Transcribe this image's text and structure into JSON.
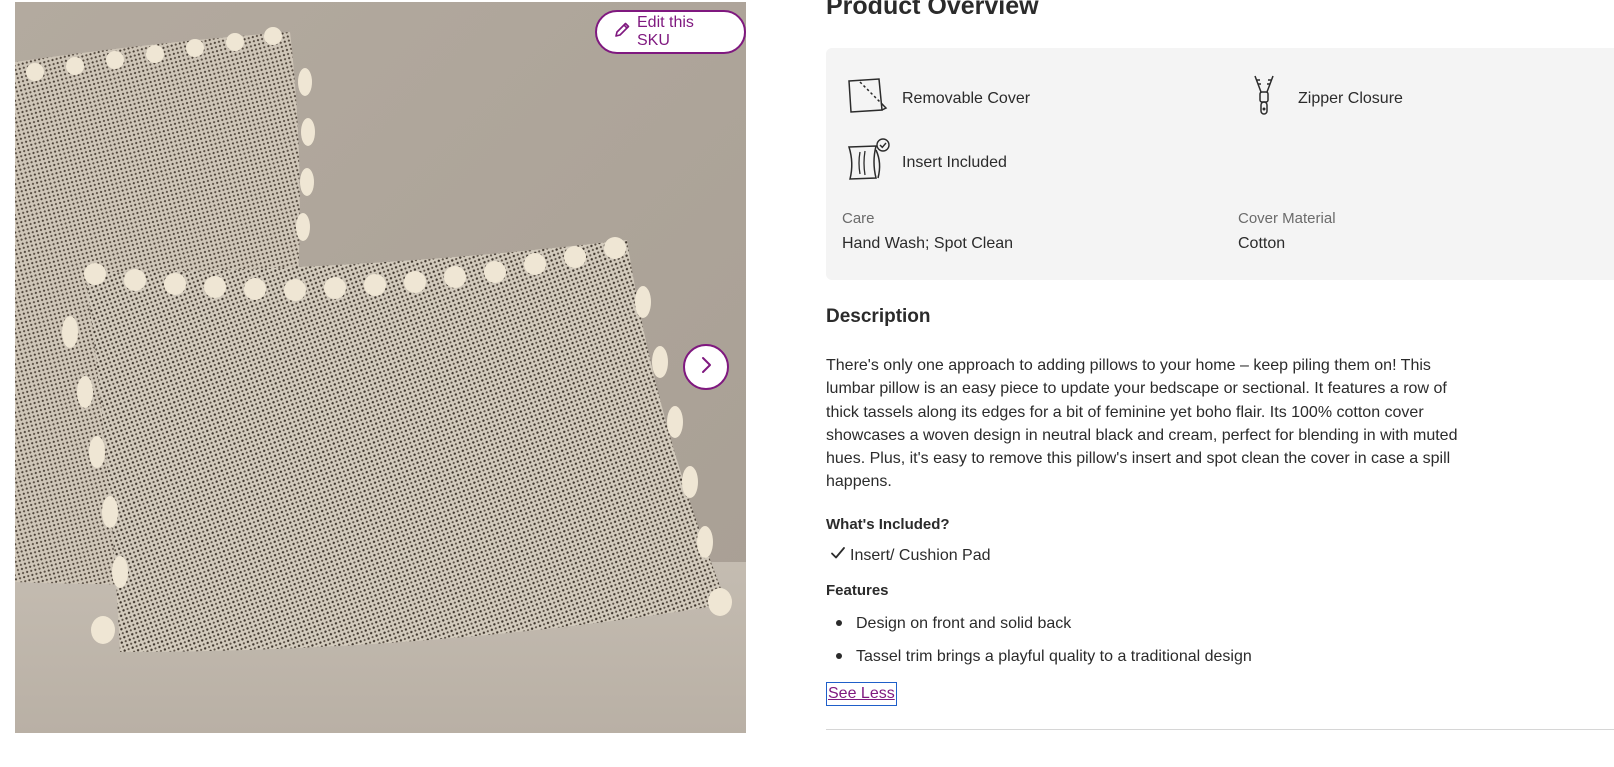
{
  "gallery": {
    "edit_label": "Edit this SKU",
    "edit_icon": "pencil-icon",
    "next_icon": "chevron-right-icon"
  },
  "overview": {
    "title": "Product Overview",
    "features": [
      {
        "label": "Removable Cover",
        "icon": "removable-cover-icon"
      },
      {
        "label": "Zipper Closure",
        "icon": "zipper-icon"
      },
      {
        "label": "Insert Included",
        "icon": "insert-included-icon"
      }
    ],
    "specs": [
      {
        "label": "Care",
        "value": "Hand Wash; Spot Clean"
      },
      {
        "label": "Cover Material",
        "value": "Cotton"
      }
    ]
  },
  "description": {
    "title": "Description",
    "text": "There's only one approach to adding pillows to your home – keep piling them on! This lumbar pillow is an easy piece to update your bedscape or sectional. It features a row of thick tassels along its edges for a bit of feminine yet boho flair. Its 100% cotton cover showcases a woven design in neutral black and cream, perfect for blending in with muted hues. Plus, it's easy to remove this pillow's insert and spot clean the cover in case a spill happens.",
    "included_title": "What's Included?",
    "included_items": [
      "Insert/ Cushion Pad"
    ],
    "features_title": "Features",
    "features": [
      "Design on front and solid back",
      "Tassel trim brings a playful quality to a traditional design"
    ],
    "see_less_label": "See Less"
  },
  "colors": {
    "brand": "#7f187f",
    "panel_bg": "#f4f4f4",
    "text": "#2b2b2b",
    "muted_text": "#6b6b6b",
    "focus_outline": "#1f5fc9"
  }
}
